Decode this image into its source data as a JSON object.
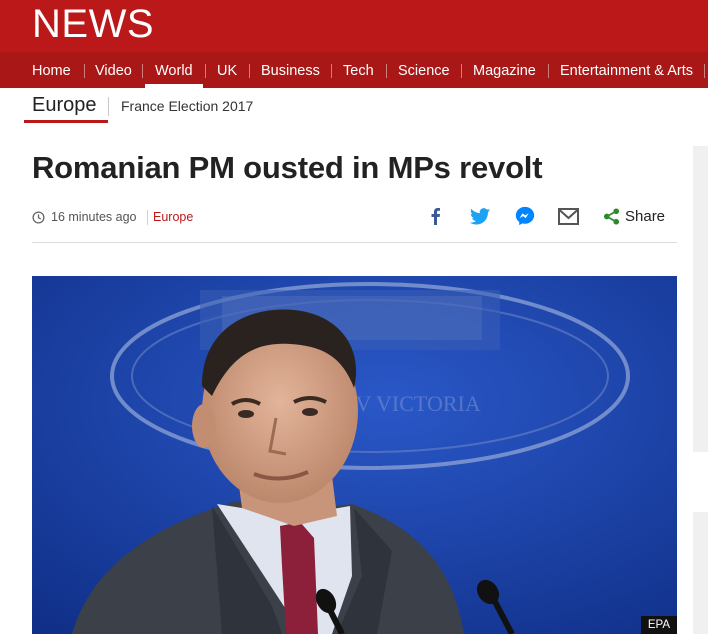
{
  "site": {
    "logo": "NEWS"
  },
  "nav": {
    "items": [
      {
        "label": "Home"
      },
      {
        "label": "Video"
      },
      {
        "label": "World"
      },
      {
        "label": "UK"
      },
      {
        "label": "Business"
      },
      {
        "label": "Tech"
      },
      {
        "label": "Science"
      },
      {
        "label": "Magazine"
      },
      {
        "label": "Entertainment & Arts"
      }
    ],
    "active": "World"
  },
  "subnav": {
    "current": "Europe",
    "links": [
      {
        "label": "France Election 2017"
      }
    ]
  },
  "article": {
    "headline": "Romanian PM ousted in MPs revolt",
    "timestamp": "16 minutes ago",
    "section": "Europe",
    "share": {
      "label": "Share",
      "icons": [
        "facebook-icon",
        "twitter-icon",
        "messenger-icon",
        "email-icon",
        "share-icon"
      ]
    },
    "image": {
      "credit": "EPA"
    }
  },
  "colors": {
    "brand_red": "#bb1919",
    "nav_red": "#a91717",
    "section_red": "#bb1919"
  }
}
